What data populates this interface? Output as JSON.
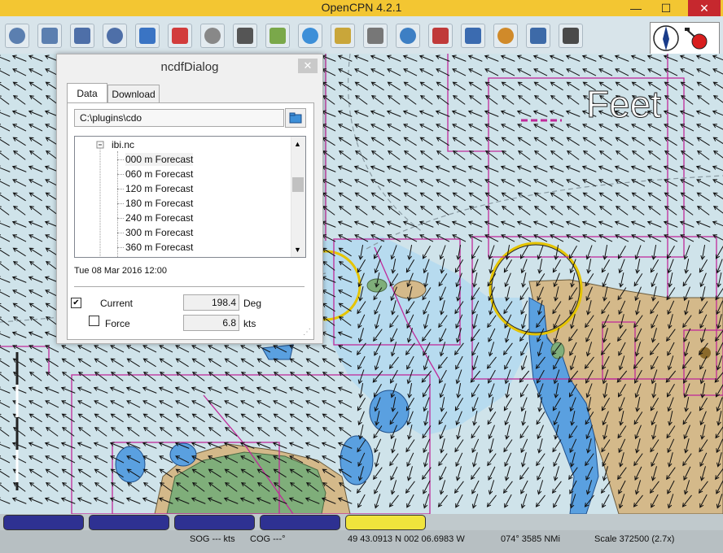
{
  "window": {
    "title": "OpenCPN 4.2.1",
    "minimize_glyph": "—",
    "maximize_glyph": "☐",
    "close_glyph": "✕",
    "titlebar_color": "#f3c632"
  },
  "toolbar": {
    "buttons": [
      {
        "icon": "zoom-in-icon"
      },
      {
        "icon": "zoom-out-icon"
      },
      {
        "icon": "scale-in-icon"
      },
      {
        "icon": "scale-out-icon"
      },
      {
        "icon": "route-icon"
      },
      {
        "icon": "follow-ship-icon"
      },
      {
        "icon": "settings-icon"
      },
      {
        "icon": "text-icon"
      },
      {
        "icon": "current-tide-icon"
      },
      {
        "icon": "tide-icon"
      },
      {
        "icon": "quilt-icon"
      },
      {
        "icon": "print-icon"
      },
      {
        "icon": "route-manager-icon"
      },
      {
        "icon": "track-icon"
      },
      {
        "icon": "color-scheme-icon"
      },
      {
        "icon": "mob-icon"
      },
      {
        "icon": "help-icon"
      },
      {
        "icon": "grib-icon"
      }
    ],
    "compass": {
      "icon": "compass-icon",
      "gps_icon": "gps-status-icon"
    }
  },
  "chart": {
    "colors": {
      "sea": "#cfe3ea",
      "shallow": "#a9d3f2",
      "deep_blue": "#5aa0e0",
      "land": "#d4b98a",
      "green": "#7fae7a",
      "boundary": "#c02a9a",
      "arrows": "#111111"
    },
    "overlay_text": "Feet"
  },
  "dialog": {
    "title": "ncdfDialog",
    "close_glyph": "✕",
    "tabs": [
      "Data",
      "Download"
    ],
    "active_tab": "Data",
    "path": "C:\\plugins\\cdo",
    "tree": {
      "root": "ibi.nc",
      "items": [
        "000 m Forecast",
        "060 m Forecast",
        "120 m Forecast",
        "180 m Forecast",
        "240 m Forecast",
        "300 m Forecast",
        "360 m Forecast"
      ],
      "selected_index": 0
    },
    "datetime": "Tue 08 Mar 2016 12:00",
    "current": {
      "label": "Current",
      "checked": true,
      "value": "198.4",
      "unit": "Deg"
    },
    "force": {
      "label": "Force",
      "checked": false,
      "value": "6.8",
      "unit": "kts"
    }
  },
  "statusbar": {
    "quilt_buttons": [
      {
        "active": false
      },
      {
        "active": false
      },
      {
        "active": false
      },
      {
        "active": false
      },
      {
        "active": true
      }
    ],
    "sog": "SOG --- kts",
    "cog": "COG ---°",
    "position": "49 43.0913 N   002 06.6983 W",
    "bearing": "074°  3585 NMi",
    "scale": "Scale 372500 (2.7x)"
  }
}
